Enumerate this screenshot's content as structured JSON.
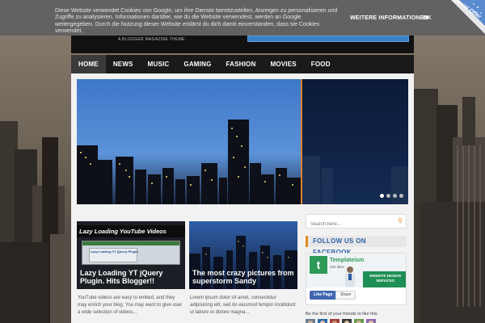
{
  "cookie_bar": {
    "message": "Diese Website verwendet Cookies von Google, um ihre Dienste bereitzustellen, Anzeigen zu personalisieren und Zugriffe zu analysieren. Informationen darüber, wie du die Website verwendest, werden an Google weitergegeben. Durch die Nutzung dieser Website erklärst du dich damit einverstanden, dass sie Cookies verwendet.",
    "more_info_label": "WEITERE INFORMATIONEN",
    "ok_label": "OK"
  },
  "corner_badge": {
    "text": "Special Offer"
  },
  "header": {
    "tagline": "A BLOGGER MAGAZINE THEME"
  },
  "nav": {
    "items": [
      {
        "label": "HOME",
        "active": true
      },
      {
        "label": "NEWS"
      },
      {
        "label": "MUSIC"
      },
      {
        "label": "GAMING"
      },
      {
        "label": "FASHION"
      },
      {
        "label": "MOVIES"
      },
      {
        "label": "FOOD"
      }
    ]
  },
  "slider": {
    "dots": 4,
    "active_index": 0
  },
  "posts": [
    {
      "thumb_heading": "Lazy Loading YouTube Videos",
      "thumb_screen_label": "Lazy Loading YT jQuery Plugin",
      "title": "Lazy Loading YT jQuery Plugin. Hits Blogger!!",
      "excerpt": "YouTube videos are easy to embed, and they may enrich your blog. You may want to give user a wide selection of videos..."
    },
    {
      "title": "The most crazy pictures from superstorm Sandy",
      "excerpt": "Lorem ipsum dolor sit amet, consectetur adipisicing elit, sed do eiusmod tempor incididunt ut labore et dolore magna..."
    }
  ],
  "sidebar": {
    "search_placeholder": "Search here...",
    "facebook_heading": "FOLLOW US ON FACEBOOK",
    "fb_widget": {
      "logo_letter": "t",
      "page_name": "Templateism",
      "likes_count": "292 likes",
      "promo_text": "WEBSITE DESIGN SERVICES",
      "like_button": "Like Page",
      "share_button": "Share"
    },
    "friends_text": "Be the first of your friends to like this"
  },
  "colors": {
    "accent": "#e08a20",
    "nav_bg": "#1a1a1a",
    "facebook_heading_text": "#2a5fa8",
    "fb_green": "#2d9a57"
  }
}
